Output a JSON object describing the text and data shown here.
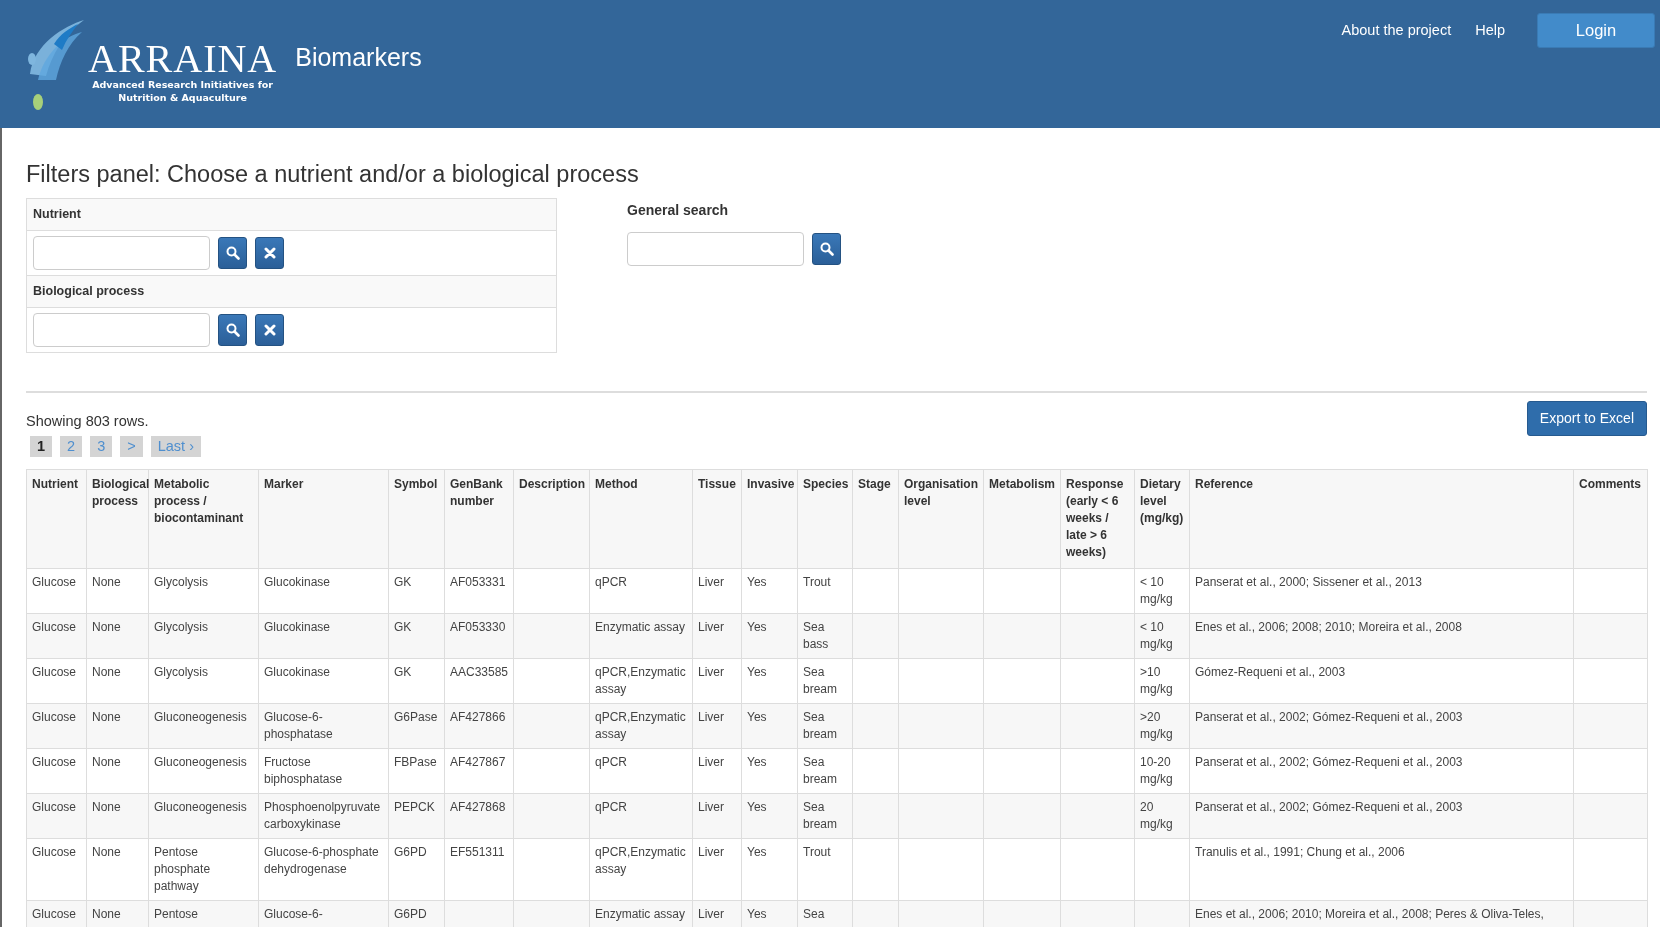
{
  "header": {
    "brand_name": "ARRAINA",
    "tagline": [
      "Advanced Research Initiatives for",
      "Nutrition & Aquaculture"
    ],
    "app_title": "Biomarkers",
    "nav": [
      {
        "label": "About the project"
      },
      {
        "label": "Help"
      }
    ],
    "login_button": "Login"
  },
  "filters": {
    "title": "Filters panel: Choose a nutrient and/or a biological process",
    "sections": [
      {
        "label": "Nutrient"
      },
      {
        "label": "Biological process"
      }
    ],
    "general_search": {
      "label": "General search"
    }
  },
  "results": {
    "summary": "Showing 803 rows.",
    "pages": [
      {
        "label": "1",
        "selected": true
      },
      {
        "label": "2",
        "selected": false
      },
      {
        "label": "3",
        "selected": false
      },
      {
        "label": ">",
        "selected": false
      },
      {
        "label": "Last ›",
        "selected": false
      }
    ],
    "export_button": "Export to Excel"
  },
  "table": {
    "columns": [
      "Nutrient",
      "Biological process",
      "Metabolic process / biocontaminant",
      "Marker",
      "Symbol",
      "GenBank number",
      "Description",
      "Method",
      "Tissue",
      "Invasive",
      "Species",
      "Stage",
      "Organisation level",
      "Metabolism",
      "Response (early < 6 weeks / late > 6 weeks)",
      "Dietary level (mg/kg)",
      "Reference",
      "Comments"
    ],
    "rows": [
      [
        "Glucose",
        "None",
        "Glycolysis",
        "Glucokinase",
        "GK",
        "AF053331",
        "",
        "qPCR",
        "Liver",
        "Yes",
        "Trout",
        "",
        "",
        "",
        "",
        "< 10 mg/kg",
        "Panserat et al., 2000; Sissener et al., 2013",
        ""
      ],
      [
        "Glucose",
        "None",
        "Glycolysis",
        "Glucokinase",
        "GK",
        "AF053330",
        "",
        "Enzymatic assay",
        "Liver",
        "Yes",
        "Sea bass",
        "",
        "",
        "",
        "",
        "< 10 mg/kg",
        "Enes et al., 2006; 2008; 2010; Moreira et al., 2008",
        ""
      ],
      [
        "Glucose",
        "None",
        "Glycolysis",
        "Glucokinase",
        "GK",
        "AAC33585",
        "",
        "qPCR,Enzymatic assay",
        "Liver",
        "Yes",
        "Sea bream",
        "",
        "",
        "",
        "",
        ">10 mg/kg",
        "Gómez-Requeni et al., 2003",
        ""
      ],
      [
        "Glucose",
        "None",
        "Gluconeogenesis",
        "Glucose-6-phosphatase",
        "G6Pase",
        "AF427866",
        "",
        "qPCR,Enzymatic assay",
        "Liver",
        "Yes",
        "Sea bream",
        "",
        "",
        "",
        "",
        ">20 mg/kg",
        "Panserat et al., 2002; Gómez-Requeni et al., 2003",
        ""
      ],
      [
        "Glucose",
        "None",
        "Gluconeogenesis",
        "Fructose biphosphatase",
        "FBPase",
        "AF427867",
        "",
        "qPCR",
        "Liver",
        "Yes",
        "Sea bream",
        "",
        "",
        "",
        "",
        "10-20 mg/kg",
        "Panserat et al., 2002; Gómez-Requeni et al., 2003",
        ""
      ],
      [
        "Glucose",
        "None",
        "Gluconeogenesis",
        "Phosphoenolpyruvate carboxykinase",
        "PEPCK",
        "AF427868",
        "",
        "qPCR",
        "Liver",
        "Yes",
        "Sea bream",
        "",
        "",
        "",
        "",
        "20 mg/kg",
        "Panserat et al., 2002; Gómez-Requeni et al., 2003",
        ""
      ],
      [
        "Glucose",
        "None",
        "Pentose phosphate pathway",
        "Glucose-6-phosphate dehydrogenase",
        "G6PD",
        "EF551311",
        "",
        "qPCR,Enzymatic assay",
        "Liver",
        "Yes",
        "Trout",
        "",
        "",
        "",
        "",
        "",
        "Tranulis et al., 1991; Chung et al., 2006",
        ""
      ],
      [
        "Glucose",
        "None",
        "Pentose",
        "Glucose-6-",
        "G6PD",
        "",
        "",
        "Enzymatic assay",
        "Liver",
        "Yes",
        "Sea",
        "",
        "",
        "",
        "",
        "",
        "Enes et al., 2006; 2010; Moreira et al., 2008; Peres & Oliva-Teles,",
        ""
      ]
    ]
  }
}
